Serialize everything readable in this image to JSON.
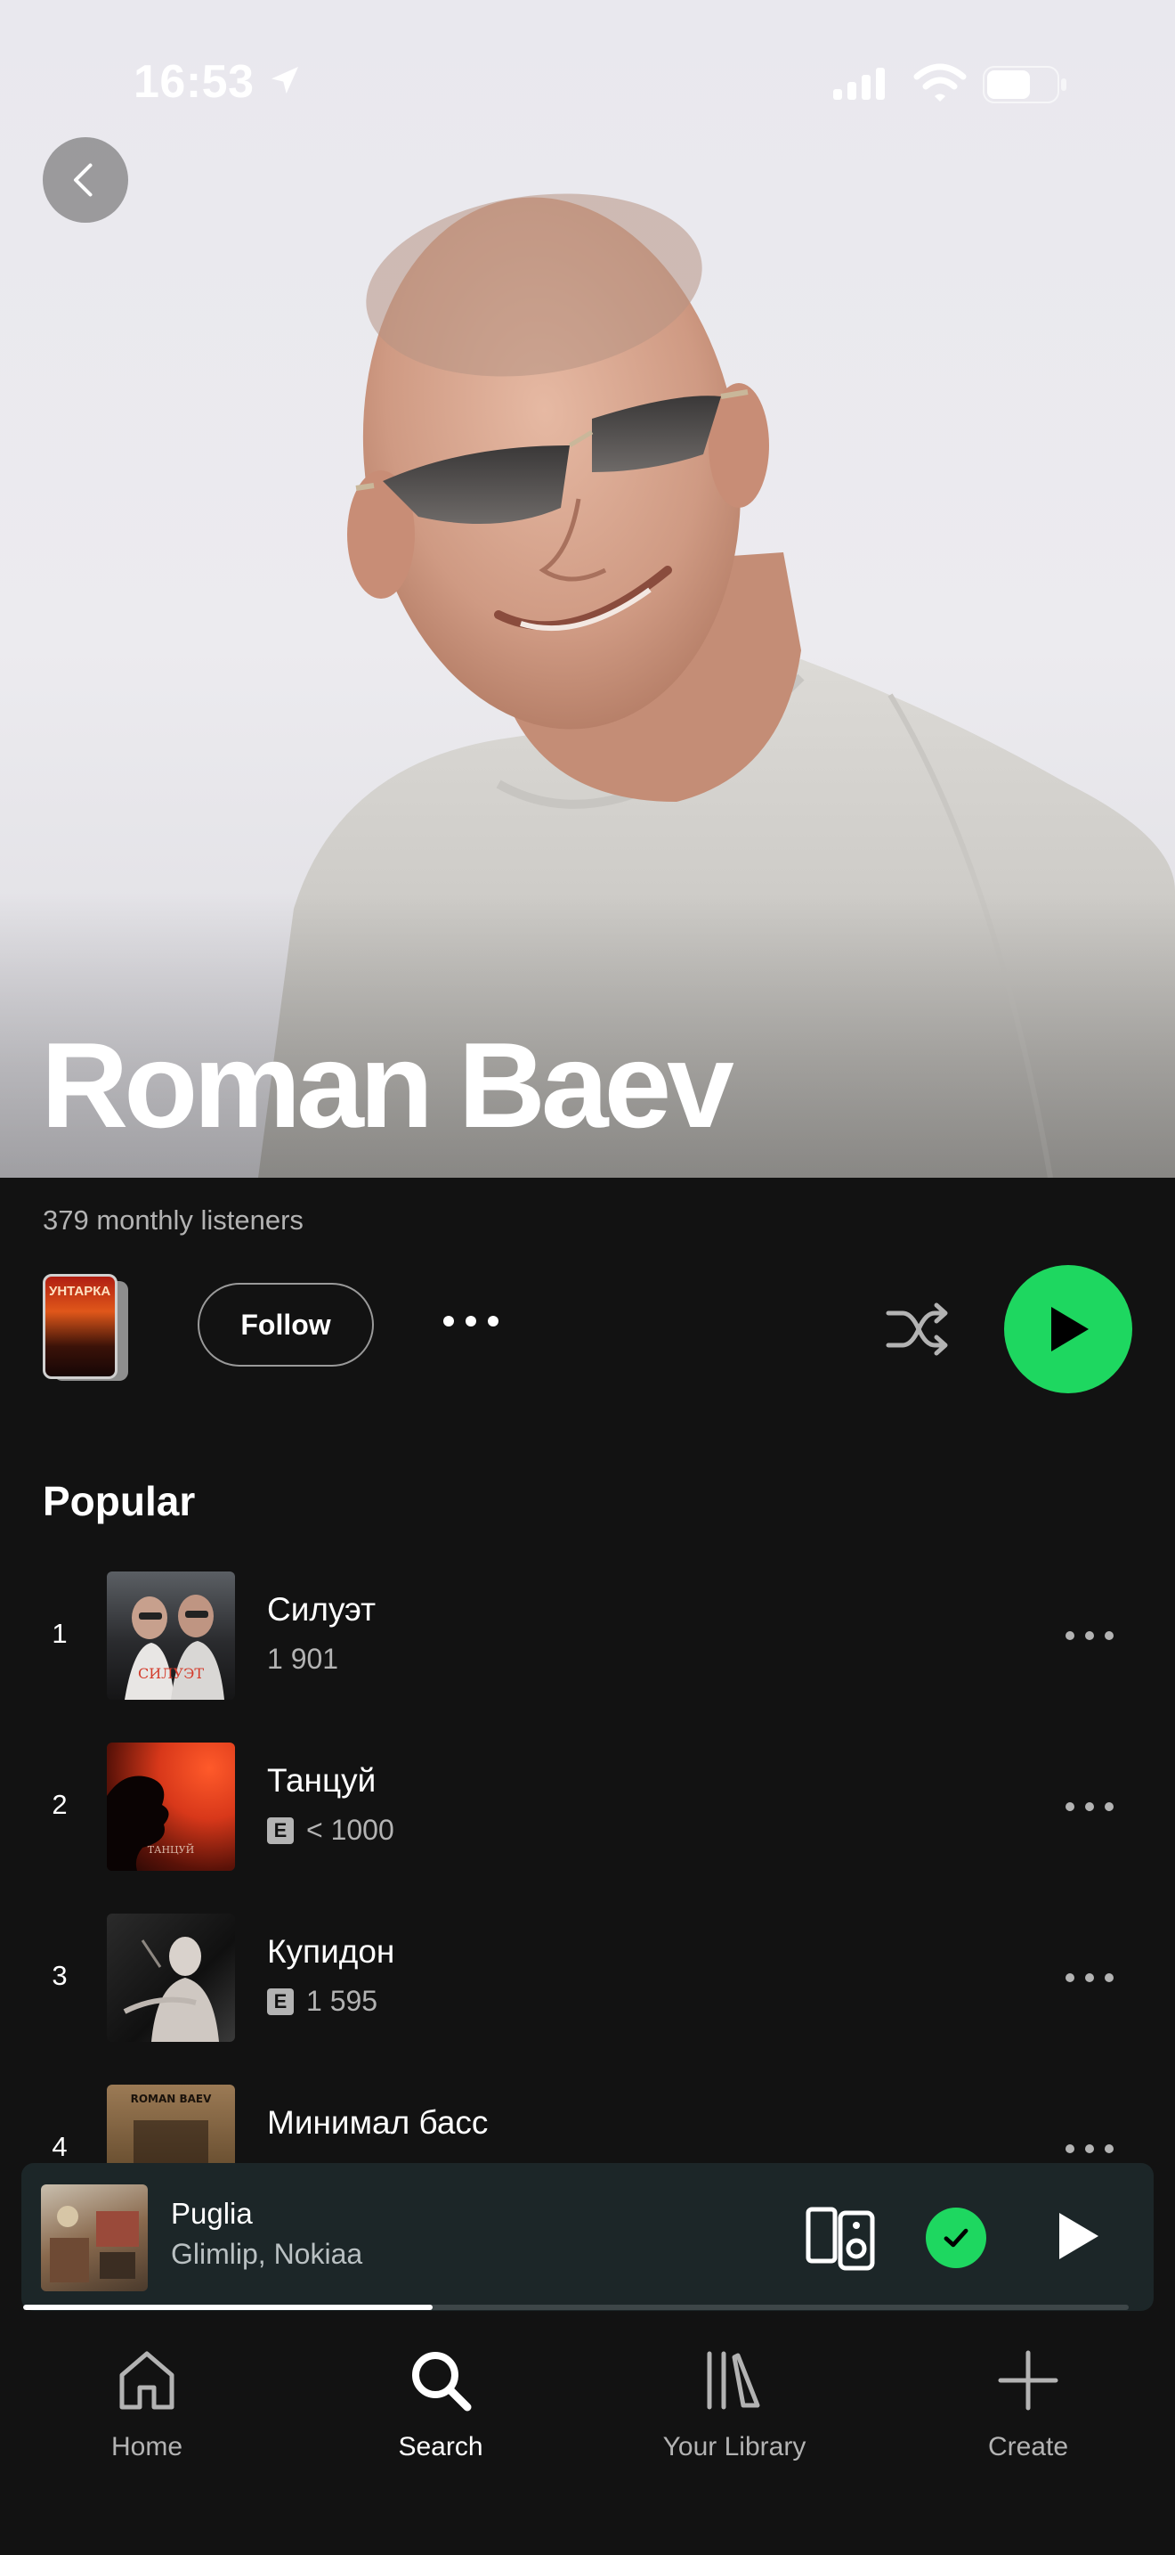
{
  "status_bar": {
    "time": "16:53"
  },
  "artist": {
    "name": "Roman Baev",
    "monthly_listeners": "379 monthly listeners",
    "follow_label": "Follow",
    "release_thumb_text": "УНТАРКА"
  },
  "popular": {
    "title": "Popular",
    "tracks": [
      {
        "rank": "1",
        "title": "Силуэт",
        "plays": "1 901",
        "explicit": false,
        "cover_text": "СИЛУЭТ"
      },
      {
        "rank": "2",
        "title": "Танцуй",
        "plays": "< 1000",
        "explicit": true,
        "cover_text": "ТАНЦУЙ"
      },
      {
        "rank": "3",
        "title": "Купидон",
        "plays": "1 595",
        "explicit": true,
        "cover_text": ""
      },
      {
        "rank": "4",
        "title": "Минимал басс",
        "plays": "",
        "explicit": false,
        "cover_text": "ROMAN BAEV"
      }
    ],
    "explicit_label": "E"
  },
  "now_playing": {
    "title": "Puglia",
    "artist": "Glimlip, Nokiaa",
    "progress_fraction": 0.37
  },
  "nav": {
    "home": "Home",
    "search": "Search",
    "library": "Your Library",
    "create": "Create",
    "active": "search"
  },
  "colors": {
    "accent": "#1ed760",
    "background": "#121212",
    "mini_player": "#1c2628"
  }
}
